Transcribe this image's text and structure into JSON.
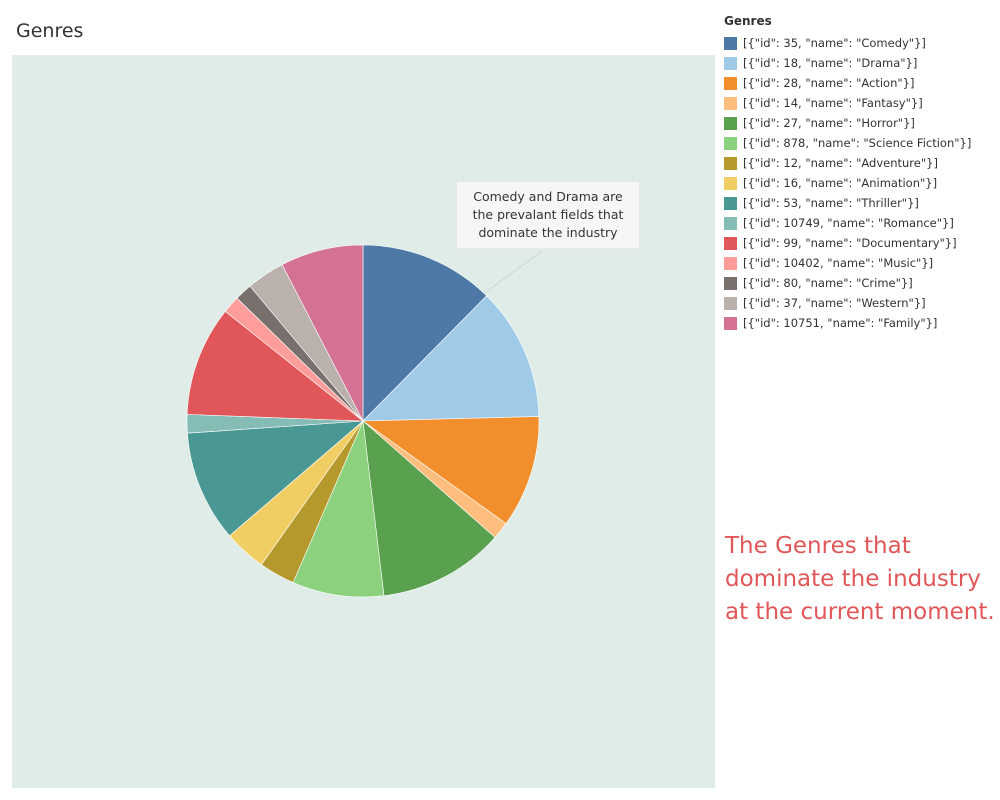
{
  "sheet": {
    "title": "Genres"
  },
  "annotation": {
    "text": "Comedy and Drama are the prevalant fields that dominate the industry"
  },
  "caption": {
    "text": "The Genres that dominate the industry at the current moment."
  },
  "legend": {
    "title": "Genres",
    "items": [
      {
        "label": "[{\"id\": 35, \"name\": \"Comedy\"}]",
        "color": "#4e79a7"
      },
      {
        "label": "[{\"id\": 18, \"name\": \"Drama\"}]",
        "color": "#a0cbe8"
      },
      {
        "label": "[{\"id\": 28, \"name\": \"Action\"}]",
        "color": "#f28e2b"
      },
      {
        "label": "[{\"id\": 14, \"name\": \"Fantasy\"}]",
        "color": "#ffbe7d"
      },
      {
        "label": "[{\"id\": 27, \"name\": \"Horror\"}]",
        "color": "#59a14f"
      },
      {
        "label": "[{\"id\": 878, \"name\": \"Science Fiction\"}]",
        "color": "#8cd17d"
      },
      {
        "label": "[{\"id\": 12, \"name\": \"Adventure\"}]",
        "color": "#b6992d"
      },
      {
        "label": "[{\"id\": 16, \"name\": \"Animation\"}]",
        "color": "#f1ce63"
      },
      {
        "label": "[{\"id\": 53, \"name\": \"Thriller\"}]",
        "color": "#499894"
      },
      {
        "label": "[{\"id\": 10749, \"name\": \"Romance\"}]",
        "color": "#86bcb6"
      },
      {
        "label": "[{\"id\": 99, \"name\": \"Documentary\"}]",
        "color": "#e15759"
      },
      {
        "label": "[{\"id\": 10402, \"name\": \"Music\"}]",
        "color": "#ff9d9a"
      },
      {
        "label": "[{\"id\": 80, \"name\": \"Crime\"}]",
        "color": "#79706e"
      },
      {
        "label": "[{\"id\": 37, \"name\": \"Western\"}]",
        "color": "#bab0ac"
      },
      {
        "label": "[{\"id\": 10751, \"name\": \"Family\"}]",
        "color": "#d37295"
      }
    ]
  },
  "chart_data": {
    "type": "pie",
    "title": "Genres",
    "legend_position": "right",
    "categories": [
      "[{\"id\": 35, \"name\": \"Comedy\"}]",
      "[{\"id\": 18, \"name\": \"Drama\"}]",
      "[{\"id\": 28, \"name\": \"Action\"}]",
      "[{\"id\": 14, \"name\": \"Fantasy\"}]",
      "[{\"id\": 27, \"name\": \"Horror\"}]",
      "[{\"id\": 878, \"name\": \"Science Fiction\"}]",
      "[{\"id\": 12, \"name\": \"Adventure\"}]",
      "[{\"id\": 16, \"name\": \"Animation\"}]",
      "[{\"id\": 53, \"name\": \"Thriller\"}]",
      "[{\"id\": 10749, \"name\": \"Romance\"}]",
      "[{\"id\": 99, \"name\": \"Documentary\"}]",
      "[{\"id\": 10402, \"name\": \"Music\"}]",
      "[{\"id\": 80, \"name\": \"Crime\"}]",
      "[{\"id\": 37, \"name\": \"Western\"}]",
      "[{\"id\": 10751, \"name\": \"Family\"}]"
    ],
    "values": [
      12.4,
      12.2,
      10.3,
      1.6,
      11.6,
      8.4,
      3.3,
      3.9,
      10.2,
      1.7,
      10.1,
      1.6,
      1.6,
      3.5,
      7.6
    ],
    "colors": [
      "#4e79a7",
      "#a0cbe8",
      "#f28e2b",
      "#ffbe7d",
      "#59a14f",
      "#8cd17d",
      "#b6992d",
      "#f1ce63",
      "#499894",
      "#86bcb6",
      "#e15759",
      "#ff9d9a",
      "#79706e",
      "#bab0ac",
      "#d37295"
    ]
  }
}
